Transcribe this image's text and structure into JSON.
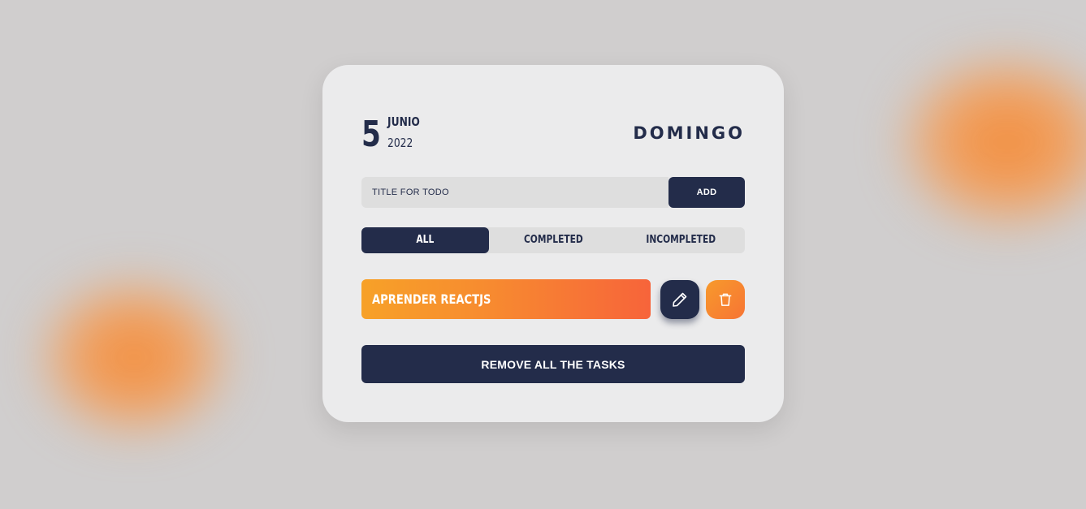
{
  "colors": {
    "background": "#d0cece",
    "card": "#ebebec",
    "navy": "#232c4a",
    "input_bg": "#dedede",
    "accent_orange": "#f78a30",
    "accent_red_orange": "#f7643a",
    "accent_yellow_orange": "#f7a128"
  },
  "date": {
    "day": "5",
    "month": "JUNIO",
    "year": "2022",
    "weekday": "DOMINGO"
  },
  "form": {
    "input_placeholder": "TITLE FOR TODO",
    "input_value": "",
    "add_label": "ADD"
  },
  "filters": {
    "selected": "ALL",
    "tabs": [
      {
        "label": "ALL"
      },
      {
        "label": "COMPLETED"
      },
      {
        "label": "INCOMPLETED"
      }
    ]
  },
  "tasks": [
    {
      "title": "APRENDER REACTJS",
      "edit_icon": "pencil-icon",
      "delete_icon": "trash-icon"
    }
  ],
  "remove_all_label": "REMOVE ALL THE TASKS"
}
